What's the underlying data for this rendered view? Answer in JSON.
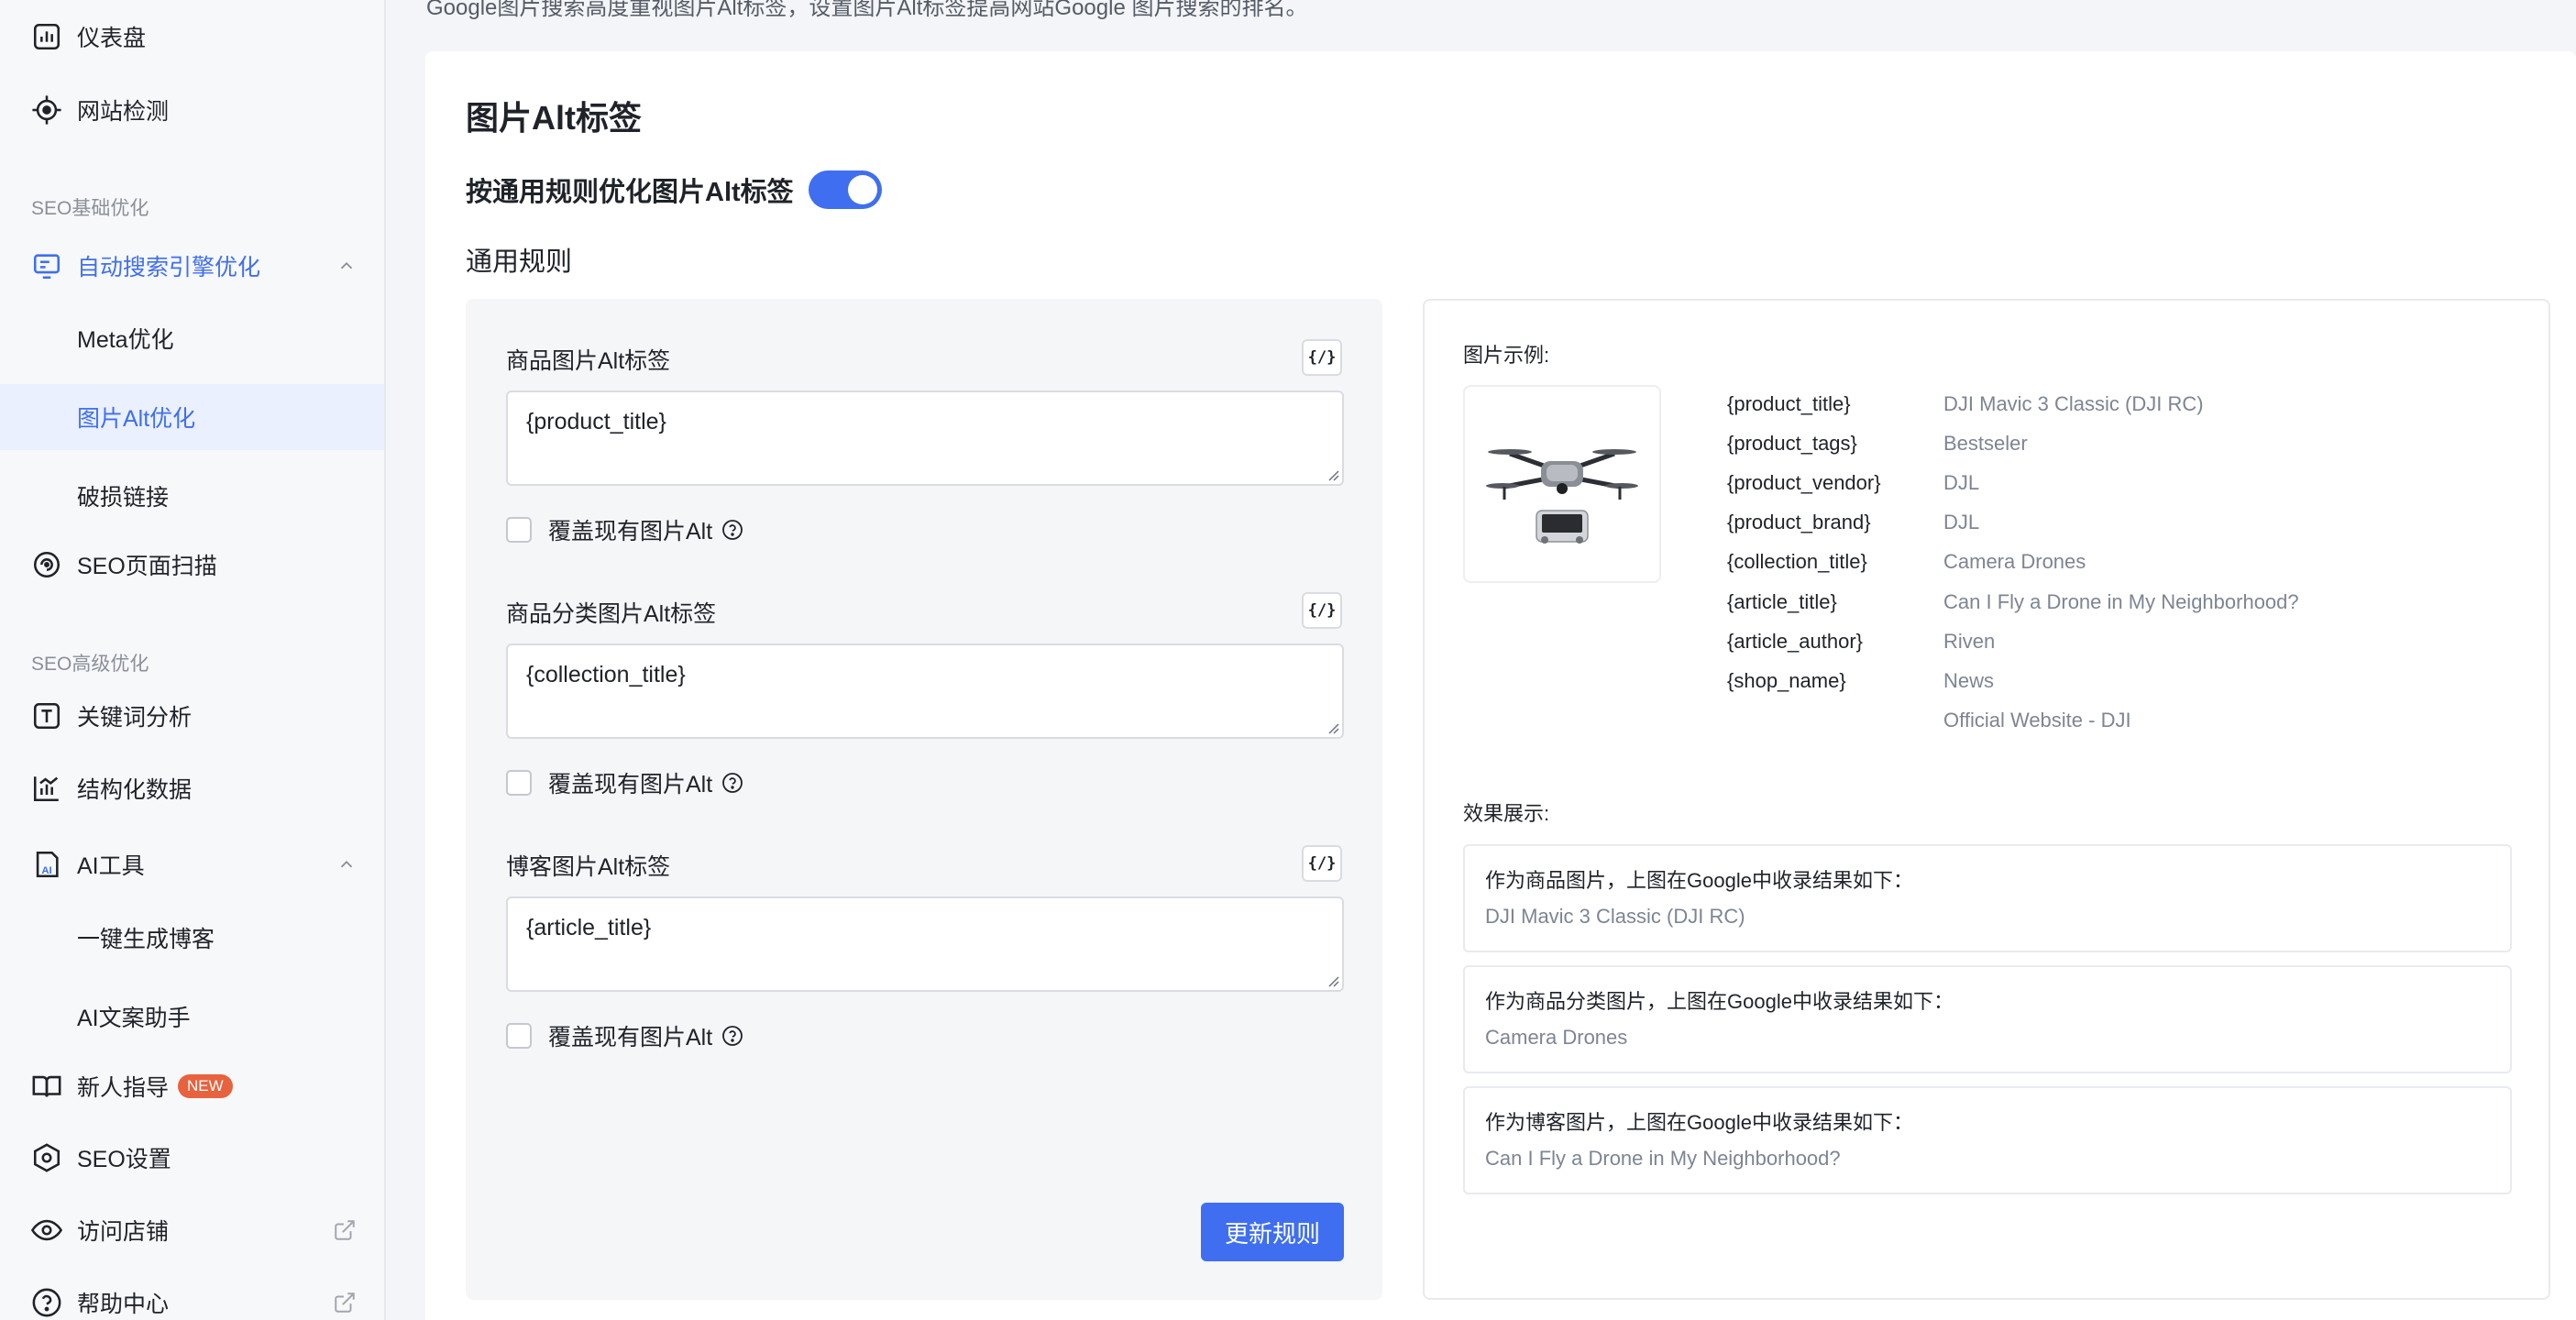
{
  "top_description": "Google图片搜索高度重视图片Alt标签，设置图片Alt标签提高网站Google 图片搜索的排名。",
  "sidebar": {
    "dashboard": "仪表盘",
    "site_check": "网站检测",
    "section_basic": "SEO基础优化",
    "auto_seo": "自动搜索引擎优化",
    "meta": "Meta优化",
    "img_alt": "图片Alt优化",
    "broken_links": "破损链接",
    "page_scan": "SEO页面扫描",
    "section_advanced": "SEO高级优化",
    "keywords": "关键词分析",
    "structured": "结构化数据",
    "ai_tools": "AI工具",
    "blog_gen": "一键生成博客",
    "ai_copy": "AI文案助手",
    "guide": "新人指导",
    "guide_badge": "NEW",
    "seo_settings": "SEO设置",
    "visit_store": "访问店铺",
    "help": "帮助中心"
  },
  "main": {
    "title": "图片Alt标签",
    "toggle_label": "按通用规则优化图片Alt标签",
    "toggle_on": true,
    "rules_heading": "通用规则",
    "var_button": "{/}",
    "fields": [
      {
        "label": "商品图片Alt标签",
        "value": "{product_title}",
        "override": "覆盖现有图片Alt"
      },
      {
        "label": "商品分类图片Alt标签",
        "value": "{collection_title}",
        "override": "覆盖现有图片Alt"
      },
      {
        "label": "博客图片Alt标签",
        "value": "{article_title}",
        "override": "覆盖现有图片Alt"
      }
    ],
    "update_button": "更新规则"
  },
  "preview": {
    "example_label": "图片示例:",
    "variables": [
      {
        "key": "{product_title}",
        "value": "DJI Mavic 3 Classic (DJI RC)"
      },
      {
        "key": "{product_tags}",
        "value": "Bestseler"
      },
      {
        "key": "{product_vendor}",
        "value": "DJL"
      },
      {
        "key": "{product_brand}",
        "value": "DJL"
      },
      {
        "key": "{collection_title}",
        "value": "Camera Drones"
      },
      {
        "key": "{article_title}",
        "value": "Can I Fly a Drone in My Neighborhood?"
      },
      {
        "key": "{article_author}",
        "value": "Riven"
      },
      {
        "key": "{shop_name}",
        "value": "News"
      },
      {
        "key": "",
        "value": "Official Website - DJI"
      }
    ],
    "effect_label": "效果展示:",
    "results": [
      {
        "title": "作为商品图片，上图在Google中收录结果如下：",
        "value": "DJI Mavic 3 Classic (DJI RC)"
      },
      {
        "title": "作为商品分类图片，上图在Google中收录结果如下：",
        "value": "Camera Drones"
      },
      {
        "title": "作为博客图片，上图在Google中收录结果如下：",
        "value": "Can I Fly a Drone in My Neighborhood?"
      }
    ]
  },
  "colors": {
    "accent": "#3f6ff0",
    "badge": "#e8623e",
    "muted": "#7d8593"
  }
}
